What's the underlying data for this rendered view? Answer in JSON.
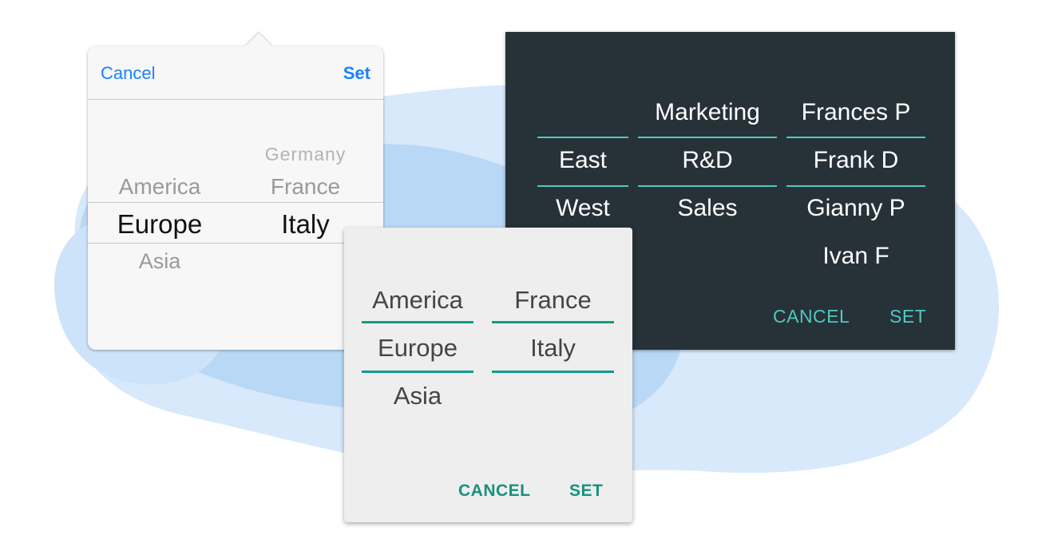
{
  "colors": {
    "ios_accent": "#1a82fb",
    "dark_background": "#263238",
    "dark_accent": "#4ec9c0",
    "light_background": "#eeeeee",
    "light_accent": "#129a8a",
    "blob_color": "#bcd9f7"
  },
  "ios_picker": {
    "cancel_label": "Cancel",
    "set_label": "Set",
    "region_column": {
      "items": [
        "America",
        "Europe",
        "Asia"
      ],
      "selected": "Europe"
    },
    "country_column": {
      "items": [
        "Germany",
        "France",
        "Italy"
      ],
      "selected": "Italy"
    }
  },
  "dark_picker": {
    "region_column": {
      "items": [
        "East",
        "West"
      ],
      "selected": "East"
    },
    "department_column": {
      "items": [
        "Marketing",
        "R&D",
        "Sales"
      ],
      "selected": "R&D"
    },
    "person_column": {
      "items": [
        "Frances P",
        "Frank D",
        "Gianny P",
        "Ivan F"
      ],
      "selected": "Frank D"
    },
    "cancel_label": "CANCEL",
    "set_label": "SET"
  },
  "light_picker": {
    "region_column": {
      "items": [
        "America",
        "Europe",
        "Asia"
      ],
      "selected": "Europe"
    },
    "country_column": {
      "items": [
        "France",
        "Italy"
      ],
      "selected": "Italy"
    },
    "cancel_label": "CANCEL",
    "set_label": "SET"
  }
}
